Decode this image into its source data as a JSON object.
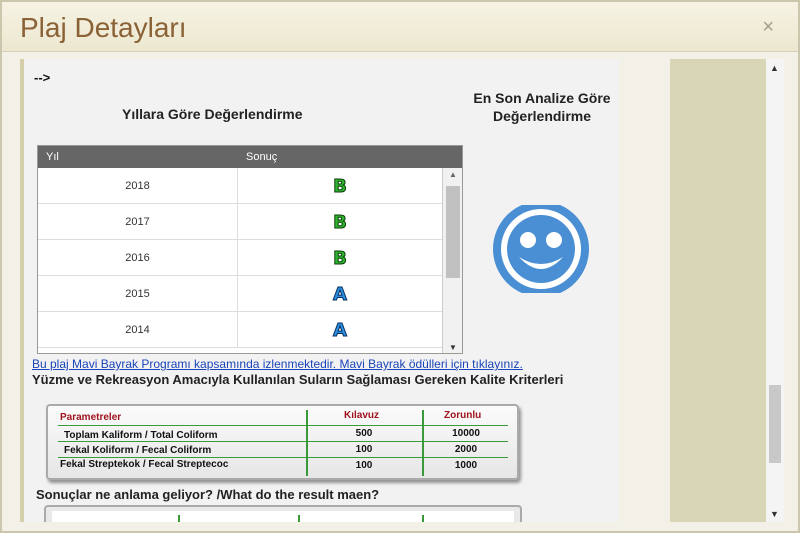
{
  "dialog": {
    "title": "Plaj Detayları",
    "close_icon": "×"
  },
  "content": {
    "arrow_text": "-->",
    "yearly_heading": "Yıllara Göre Değerlendirme",
    "latest_heading": "En Son Analize Göre Değerlendirme",
    "table": {
      "columns": [
        "Yıl",
        "Sonuç"
      ],
      "rows": [
        {
          "year": "2018",
          "grade": "B",
          "color": "#2fb52f"
        },
        {
          "year": "2017",
          "grade": "B",
          "color": "#2fb52f"
        },
        {
          "year": "2016",
          "grade": "B",
          "color": "#2fb52f"
        },
        {
          "year": "2015",
          "grade": "A",
          "color": "#2a8fe0"
        },
        {
          "year": "2014",
          "grade": "A",
          "color": "#2a8fe0"
        }
      ]
    },
    "smiley_color": "#4a8fd4",
    "mavi_link": "Bu plaj Mavi Bayrak Programı kapsamında izlenmektedir. Mavi Bayrak ödülleri için tıklayınız.",
    "criteria_title": "Yüzme ve Rekreasyon Amacıyla Kullanılan Suların Sağlaması Gereken Kalite Kriterleri",
    "criteria": {
      "headers": [
        "Parametreler",
        "Kılavuz",
        "Zorunlu"
      ],
      "rows": [
        {
          "label": "Toplam Kaliform / Total Coliform",
          "kilavuz": "500",
          "zorunlu": "10000"
        },
        {
          "label": "Fekal Koliform / Fecal Coliform",
          "kilavuz": "100",
          "zorunlu": "2000"
        },
        {
          "label": "Fekal Streptekok / Fecal Streptecoc",
          "kilavuz": "100",
          "zorunlu": "1000"
        }
      ]
    },
    "results_title": "Sonuçlar ne anlama geliyor? /What do the result maen?"
  }
}
